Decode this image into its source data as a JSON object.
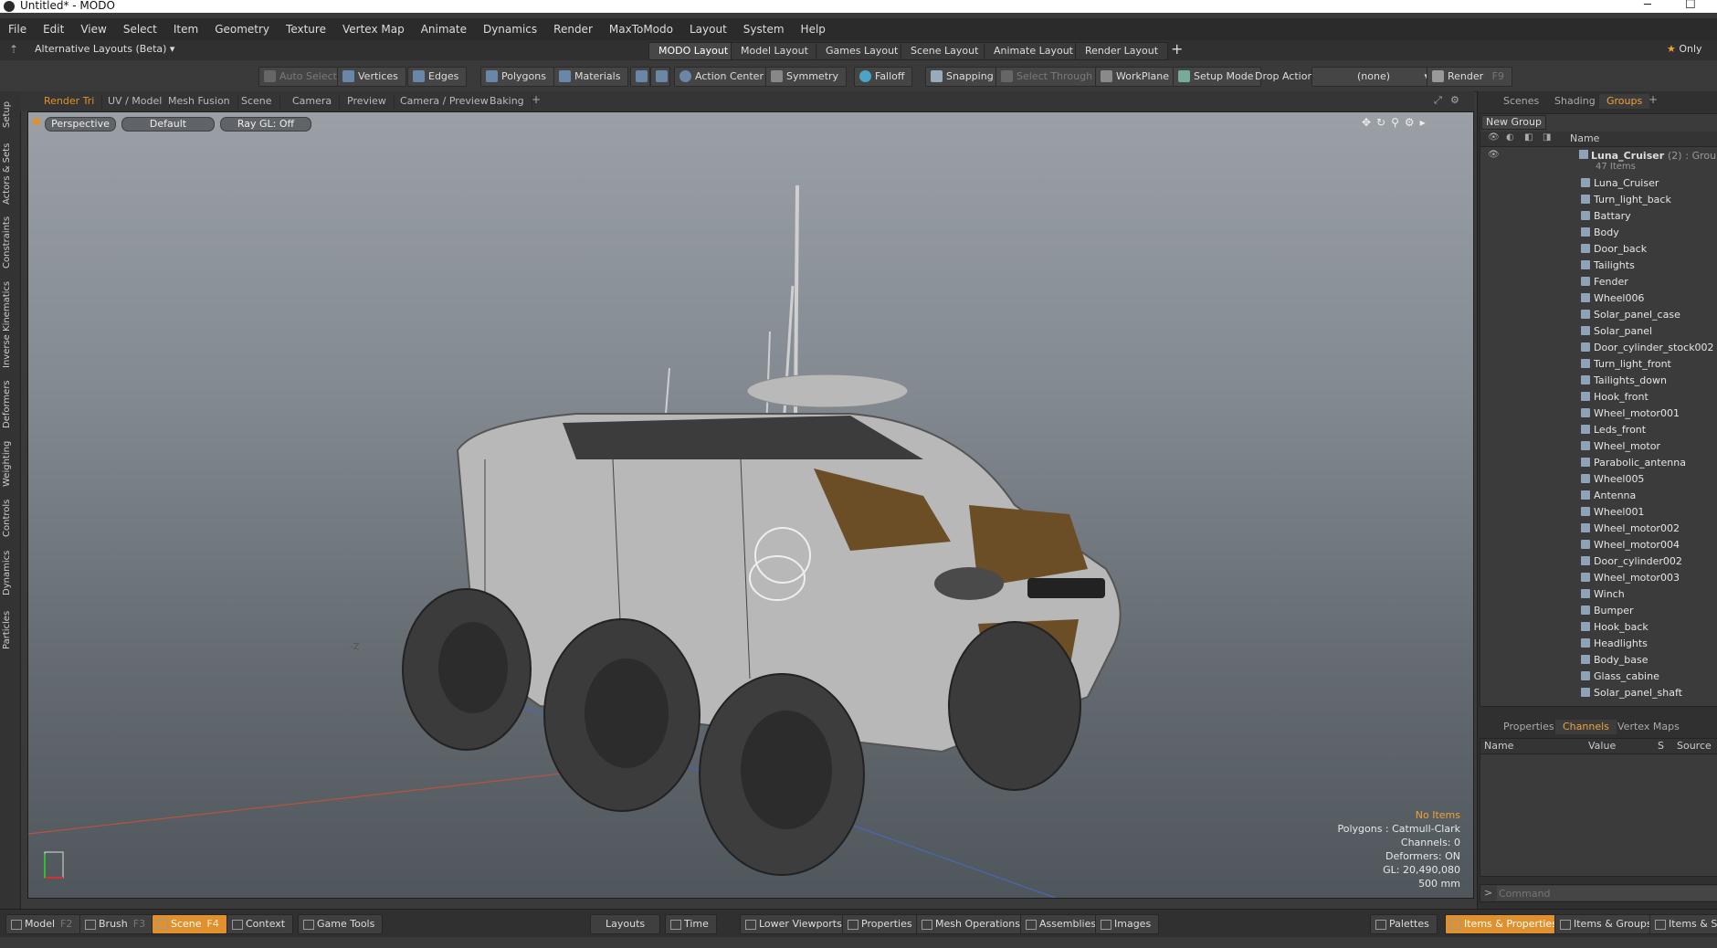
{
  "window": {
    "title": "Untitled* - MODO",
    "minimize": "─",
    "maximize": "☐"
  },
  "menu": [
    "File",
    "Edit",
    "View",
    "Select",
    "Item",
    "Geometry",
    "Texture",
    "Vertex Map",
    "Animate",
    "Dynamics",
    "Render",
    "MaxToModo",
    "Layout",
    "System",
    "Help"
  ],
  "layout_bar": {
    "alt_layouts": "Alternative Layouts (Beta)",
    "tabs": [
      "MODO Layout",
      "Model Layout",
      "Games Layout",
      "Scene Layout",
      "Animate Layout",
      "Render Layout"
    ],
    "add": "+",
    "only": "Only"
  },
  "toolbar": {
    "auto_select": "Auto Select",
    "vertices": "Vertices",
    "edges": "Edges",
    "polygons": "Polygons",
    "materials": "Materials",
    "action_center": "Action Center",
    "symmetry": "Symmetry",
    "falloff": "Falloff",
    "snapping": "Snapping",
    "select_through": "Select Through",
    "workplane": "WorkPlane",
    "setup_mode": "Setup Mode",
    "drop_action_label": "Drop Action",
    "drop_action_value": "(none)",
    "render": "Render",
    "render_key": "F9"
  },
  "left_tabs": [
    "Setup",
    "Actors & Sets",
    "Constraints",
    "Inverse Kinematics",
    "Deformers",
    "Weighting",
    "Controls",
    "Dynamics",
    "Particles"
  ],
  "viewport_tabs": [
    "Render Tri",
    "UV / Model",
    "Mesh Fusion",
    "Scene",
    "Camera",
    "Preview",
    "Camera / Preview",
    "Baking"
  ],
  "viewport": {
    "view": "Perspective",
    "style": "Default",
    "raygl": "Ray GL: Off",
    "axis_z": "-Z",
    "hud": {
      "no_items": "No Items",
      "polygons": "Polygons : Catmull-Clark",
      "channels": "Channels: 0",
      "deformers": "Deformers: ON",
      "gl": "GL: 20,490,080",
      "scale": "500 mm"
    }
  },
  "right_panel": {
    "tabs": [
      "Scenes",
      "Shading",
      "Groups"
    ],
    "new_group": "New Group",
    "name_header": "Name",
    "group": {
      "name": "Luna_Cruiser",
      "count": "(2)",
      "type": ": Group",
      "items_label": "47 Items"
    },
    "items": [
      "Luna_Cruiser",
      "Turn_light_back",
      "Battary",
      "Body",
      "Door_back",
      "Tailights",
      "Fender",
      "Wheel006",
      "Solar_panel_case",
      "Solar_panel",
      "Door_cylinder_stock002",
      "Turn_light_front",
      "Tailights_down",
      "Hook_front",
      "Wheel_motor001",
      "Leds_front",
      "Wheel_motor",
      "Parabolic_antenna",
      "Wheel005",
      "Antenna",
      "Wheel001",
      "Wheel_motor002",
      "Wheel_motor004",
      "Door_cylinder002",
      "Wheel_motor003",
      "Winch",
      "Bumper",
      "Hook_back",
      "Headlights",
      "Body_base",
      "Glass_cabine",
      "Solar_panel_shaft"
    ],
    "lower_tabs": [
      "Properties",
      "Channels",
      "Vertex Maps"
    ],
    "channel_headers": [
      "Name",
      "Value",
      "S",
      "Source"
    ],
    "command_placeholder": "Command"
  },
  "bottom_bar": {
    "model": "Model",
    "model_key": "F2",
    "brush": "Brush",
    "brush_key": "F3",
    "scene": "Scene",
    "scene_key": "F4",
    "context": "Context",
    "game_tools": "Game Tools",
    "layouts": "Layouts",
    "time": "Time",
    "lower_viewports": "Lower Viewports",
    "properties": "Properties",
    "mesh_operations": "Mesh Operations",
    "assemblies": "Assemblies",
    "images": "Images",
    "palettes": "Palettes",
    "items_properties": "Items & Properties",
    "items_groups": "Items & Groups",
    "items_sh": "Items & Sh"
  },
  "colors": {
    "accent": "#e0902d",
    "panel": "#303030",
    "viewport_top": "#9aa0a6"
  }
}
